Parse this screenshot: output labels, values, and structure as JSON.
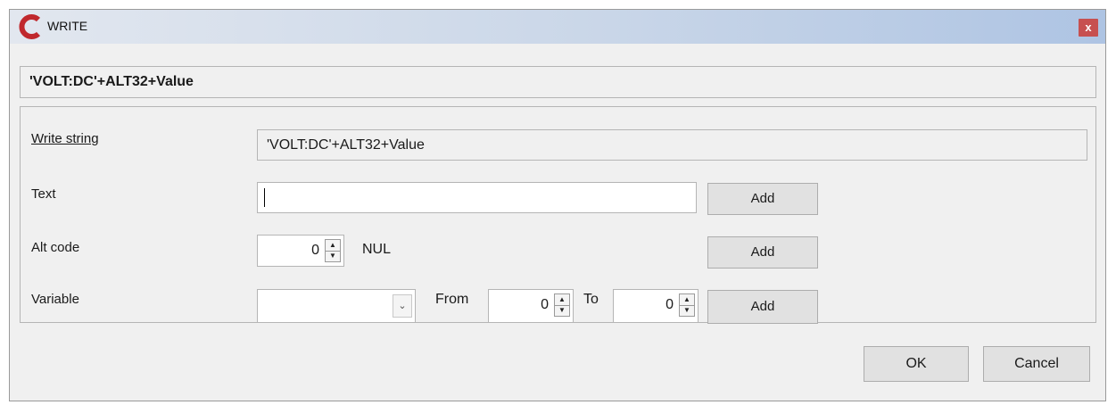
{
  "window": {
    "title": "WRITE",
    "close_label": "x",
    "command_preview": "'VOLT:DC'+ALT32+Value"
  },
  "write_string": {
    "label": "Write string",
    "value": "'VOLT:DC'+ALT32+Value"
  },
  "text_row": {
    "label": "Text",
    "value": "",
    "add_label": "Add"
  },
  "alt_code_row": {
    "label": "Alt code",
    "value": "0",
    "char_name": "NUL",
    "add_label": "Add"
  },
  "variable_row": {
    "label": "Variable",
    "selected": "",
    "from_label": "From",
    "from_value": "0",
    "to_label": "To",
    "to_value": "0",
    "add_label": "Add"
  },
  "footer": {
    "ok_label": "OK",
    "cancel_label": "Cancel"
  },
  "icons": {
    "app": "app-logo-icon",
    "close": "close-icon",
    "spin_up": "spin-up-icon",
    "spin_down": "spin-down-icon",
    "dropdown": "chevron-down-icon"
  },
  "colors": {
    "logo_red": "#c0282d",
    "close_bg": "#c75050",
    "window_bg": "#f0f0f0"
  }
}
